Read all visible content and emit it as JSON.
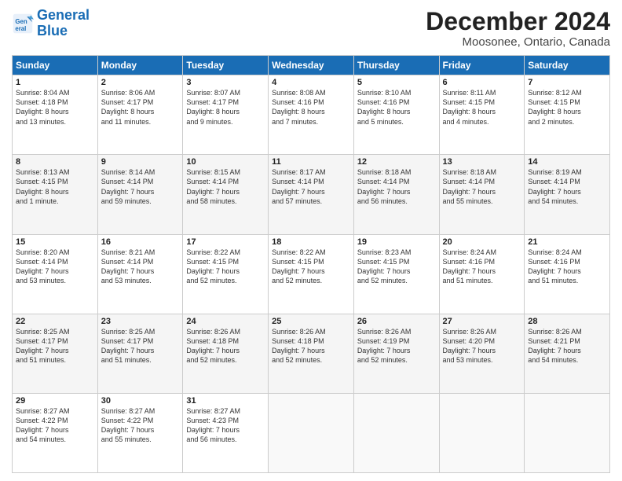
{
  "logo": {
    "line1": "General",
    "line2": "Blue"
  },
  "title": "December 2024",
  "location": "Moosonee, Ontario, Canada",
  "days_header": [
    "Sunday",
    "Monday",
    "Tuesday",
    "Wednesday",
    "Thursday",
    "Friday",
    "Saturday"
  ],
  "weeks": [
    [
      {
        "day": "1",
        "info": "Sunrise: 8:04 AM\nSunset: 4:18 PM\nDaylight: 8 hours\nand 13 minutes."
      },
      {
        "day": "2",
        "info": "Sunrise: 8:06 AM\nSunset: 4:17 PM\nDaylight: 8 hours\nand 11 minutes."
      },
      {
        "day": "3",
        "info": "Sunrise: 8:07 AM\nSunset: 4:17 PM\nDaylight: 8 hours\nand 9 minutes."
      },
      {
        "day": "4",
        "info": "Sunrise: 8:08 AM\nSunset: 4:16 PM\nDaylight: 8 hours\nand 7 minutes."
      },
      {
        "day": "5",
        "info": "Sunrise: 8:10 AM\nSunset: 4:16 PM\nDaylight: 8 hours\nand 5 minutes."
      },
      {
        "day": "6",
        "info": "Sunrise: 8:11 AM\nSunset: 4:15 PM\nDaylight: 8 hours\nand 4 minutes."
      },
      {
        "day": "7",
        "info": "Sunrise: 8:12 AM\nSunset: 4:15 PM\nDaylight: 8 hours\nand 2 minutes."
      }
    ],
    [
      {
        "day": "8",
        "info": "Sunrise: 8:13 AM\nSunset: 4:15 PM\nDaylight: 8 hours\nand 1 minute."
      },
      {
        "day": "9",
        "info": "Sunrise: 8:14 AM\nSunset: 4:14 PM\nDaylight: 7 hours\nand 59 minutes."
      },
      {
        "day": "10",
        "info": "Sunrise: 8:15 AM\nSunset: 4:14 PM\nDaylight: 7 hours\nand 58 minutes."
      },
      {
        "day": "11",
        "info": "Sunrise: 8:17 AM\nSunset: 4:14 PM\nDaylight: 7 hours\nand 57 minutes."
      },
      {
        "day": "12",
        "info": "Sunrise: 8:18 AM\nSunset: 4:14 PM\nDaylight: 7 hours\nand 56 minutes."
      },
      {
        "day": "13",
        "info": "Sunrise: 8:18 AM\nSunset: 4:14 PM\nDaylight: 7 hours\nand 55 minutes."
      },
      {
        "day": "14",
        "info": "Sunrise: 8:19 AM\nSunset: 4:14 PM\nDaylight: 7 hours\nand 54 minutes."
      }
    ],
    [
      {
        "day": "15",
        "info": "Sunrise: 8:20 AM\nSunset: 4:14 PM\nDaylight: 7 hours\nand 53 minutes."
      },
      {
        "day": "16",
        "info": "Sunrise: 8:21 AM\nSunset: 4:14 PM\nDaylight: 7 hours\nand 53 minutes."
      },
      {
        "day": "17",
        "info": "Sunrise: 8:22 AM\nSunset: 4:15 PM\nDaylight: 7 hours\nand 52 minutes."
      },
      {
        "day": "18",
        "info": "Sunrise: 8:22 AM\nSunset: 4:15 PM\nDaylight: 7 hours\nand 52 minutes."
      },
      {
        "day": "19",
        "info": "Sunrise: 8:23 AM\nSunset: 4:15 PM\nDaylight: 7 hours\nand 52 minutes."
      },
      {
        "day": "20",
        "info": "Sunrise: 8:24 AM\nSunset: 4:16 PM\nDaylight: 7 hours\nand 51 minutes."
      },
      {
        "day": "21",
        "info": "Sunrise: 8:24 AM\nSunset: 4:16 PM\nDaylight: 7 hours\nand 51 minutes."
      }
    ],
    [
      {
        "day": "22",
        "info": "Sunrise: 8:25 AM\nSunset: 4:17 PM\nDaylight: 7 hours\nand 51 minutes."
      },
      {
        "day": "23",
        "info": "Sunrise: 8:25 AM\nSunset: 4:17 PM\nDaylight: 7 hours\nand 51 minutes."
      },
      {
        "day": "24",
        "info": "Sunrise: 8:26 AM\nSunset: 4:18 PM\nDaylight: 7 hours\nand 52 minutes."
      },
      {
        "day": "25",
        "info": "Sunrise: 8:26 AM\nSunset: 4:18 PM\nDaylight: 7 hours\nand 52 minutes."
      },
      {
        "day": "26",
        "info": "Sunrise: 8:26 AM\nSunset: 4:19 PM\nDaylight: 7 hours\nand 52 minutes."
      },
      {
        "day": "27",
        "info": "Sunrise: 8:26 AM\nSunset: 4:20 PM\nDaylight: 7 hours\nand 53 minutes."
      },
      {
        "day": "28",
        "info": "Sunrise: 8:26 AM\nSunset: 4:21 PM\nDaylight: 7 hours\nand 54 minutes."
      }
    ],
    [
      {
        "day": "29",
        "info": "Sunrise: 8:27 AM\nSunset: 4:22 PM\nDaylight: 7 hours\nand 54 minutes."
      },
      {
        "day": "30",
        "info": "Sunrise: 8:27 AM\nSunset: 4:22 PM\nDaylight: 7 hours\nand 55 minutes."
      },
      {
        "day": "31",
        "info": "Sunrise: 8:27 AM\nSunset: 4:23 PM\nDaylight: 7 hours\nand 56 minutes."
      },
      null,
      null,
      null,
      null
    ]
  ]
}
